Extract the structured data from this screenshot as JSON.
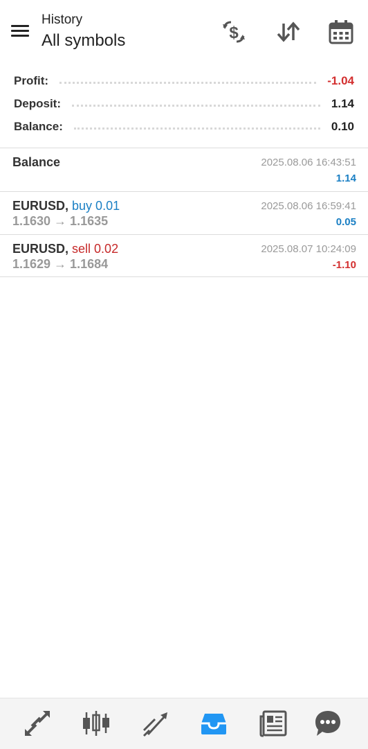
{
  "header": {
    "subtitle": "History",
    "title": "All symbols",
    "icons": [
      "menu-icon",
      "currency-exchange-icon",
      "sort-icon",
      "calendar-icon"
    ]
  },
  "summary": {
    "profit_label": "Profit:",
    "profit_value": "-1.04",
    "deposit_label": "Deposit:",
    "deposit_value": "1.14",
    "balance_label": "Balance:",
    "balance_value": "0.10"
  },
  "deals": [
    {
      "symbol": "Balance",
      "side": "",
      "prices": "",
      "time": "2025.08.06 16:43:51",
      "pl": "1.14"
    },
    {
      "symbol": "EURUSD,",
      "side": "buy 0.01",
      "prices": "1.1630 → 1.1635",
      "time": "2025.08.06 16:59:41",
      "pl": "0.05"
    },
    {
      "symbol": "EURUSD,",
      "side": "sell 0.02",
      "prices": "1.1629 → 1.1684",
      "time": "2025.08.07 10:24:09",
      "pl": "-1.10"
    }
  ],
  "colors": {
    "accent": "#1a7fc4",
    "negative": "#d32f2f",
    "active_tab": "#2196f3",
    "icon": "#555555"
  },
  "bottom_nav": [
    "quotes-icon",
    "chart-icon",
    "trade-icon",
    "history-icon",
    "news-icon",
    "chat-icon"
  ],
  "active_tab": "history-icon"
}
